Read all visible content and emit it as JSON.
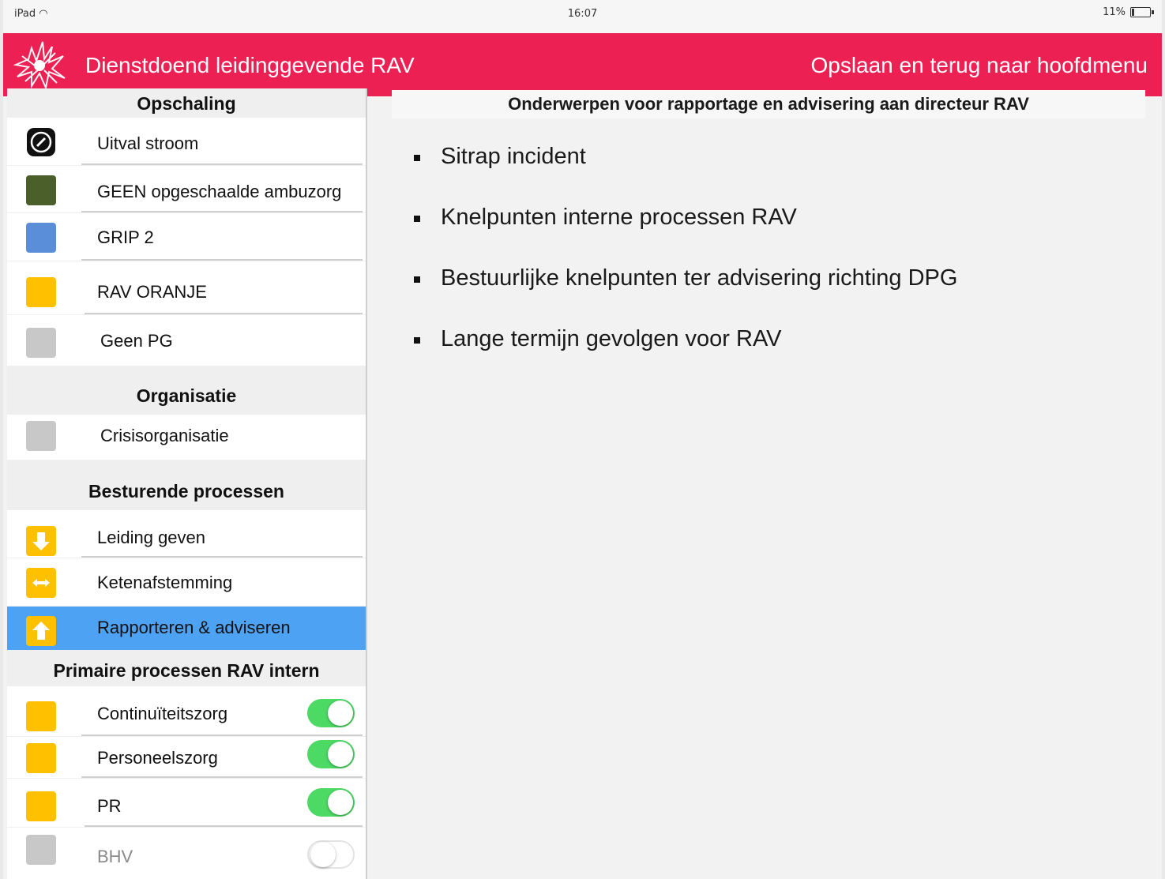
{
  "status_bar": {
    "device": "iPad",
    "time": "16:07",
    "battery": "11%"
  },
  "header": {
    "title": "Dienstdoend leidinggevende RAV",
    "back_label": "Opslaan en terug naar hoofdmenu",
    "brand_color": "#ec2053"
  },
  "sidebar": {
    "sections": [
      {
        "title": "Opschaling",
        "items": [
          {
            "label": "Uitval stroom",
            "icon": "power-failure-icon"
          },
          {
            "label": "GEEN opgeschaalde ambuzorg",
            "color": "#4a5f2a"
          },
          {
            "label": "GRIP 2",
            "color": "#5b8ed8"
          },
          {
            "label": "RAV ORANJE",
            "color": "#ffc000"
          },
          {
            "label": "Geen PG",
            "color": "#c8c8c8"
          }
        ]
      },
      {
        "title": "Organisatie",
        "items": [
          {
            "label": "Crisisorganisatie",
            "color": "#c8c8c8"
          }
        ]
      },
      {
        "title": "Besturende processen",
        "items": [
          {
            "label": "Leiding geven",
            "icon": "arrow-down-icon",
            "color": "#ffc000"
          },
          {
            "label": "Ketenafstemming",
            "icon": "arrows-horizontal-icon",
            "color": "#ffc000"
          },
          {
            "label": "Rapporteren & adviseren",
            "icon": "arrow-up-icon",
            "color": "#ffc000",
            "selected": true
          }
        ]
      },
      {
        "title": "Primaire processen RAV intern",
        "items": [
          {
            "label": "Continuïteitszorg",
            "color": "#ffc000",
            "toggle": true
          },
          {
            "label": "Personeelszorg",
            "color": "#ffc000",
            "toggle": true
          },
          {
            "label": "PR",
            "color": "#ffc000",
            "toggle": true
          },
          {
            "label": "BHV",
            "color": "#c8c8c8",
            "toggle": false
          }
        ]
      }
    ]
  },
  "main": {
    "heading": "Onderwerpen voor rapportage en advisering aan directeur RAV",
    "bullets": [
      "Sitrap incident",
      "Knelpunten interne processen RAV",
      "Bestuurlijke knelpunten ter advisering richting DPG",
      "Lange termijn gevolgen voor RAV"
    ]
  },
  "colors": {
    "selected": "#4ea2f3",
    "toggle_on": "#4cd964"
  }
}
